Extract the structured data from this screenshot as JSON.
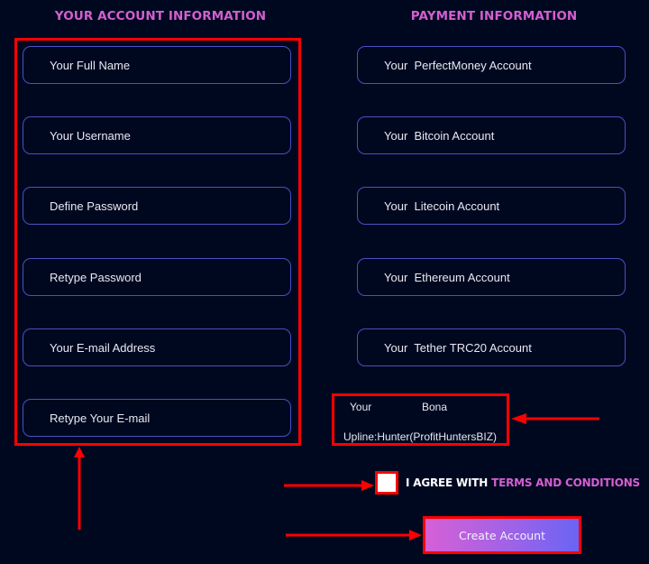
{
  "account_section": {
    "heading": "YOUR ACCOUNT INFORMATION",
    "fields": [
      {
        "placeholder": "Your Full Name",
        "value": ""
      },
      {
        "placeholder": "Your Username",
        "value": ""
      },
      {
        "placeholder": "Define Password",
        "value": ""
      },
      {
        "placeholder": "Retype Password",
        "value": ""
      },
      {
        "placeholder": "Your E-mail Address",
        "value": ""
      },
      {
        "placeholder": "Retype Your E-mail",
        "value": ""
      }
    ]
  },
  "payment_section": {
    "heading": "PAYMENT INFORMATION",
    "fields": [
      {
        "placeholder": "Your  PerfectMoney Account",
        "value": ""
      },
      {
        "placeholder": "Your  Bitcoin Account",
        "value": ""
      },
      {
        "placeholder": "Your  Litecoin Account",
        "value": ""
      },
      {
        "placeholder": "Your  Ethereum Account",
        "value": ""
      },
      {
        "placeholder": "Your  Tether TRC20 Account",
        "value": ""
      }
    ],
    "upline": {
      "label_part1": "Your",
      "label_part2": "Bona",
      "value": "Upline:Hunter(ProfitHuntersBIZ)"
    }
  },
  "agreement": {
    "prefix": "I AGREE WITH ",
    "link_text": "TERMS AND CONDITIONS",
    "checked": false
  },
  "submit": {
    "label": "Create Account"
  },
  "colors": {
    "background": "#000820",
    "heading_accent": "#d45fd0",
    "field_border": "#4b4fbf",
    "annotation_red": "#ff0000",
    "button_gradient_start": "#d660d6",
    "button_gradient_end": "#6a64f4"
  }
}
